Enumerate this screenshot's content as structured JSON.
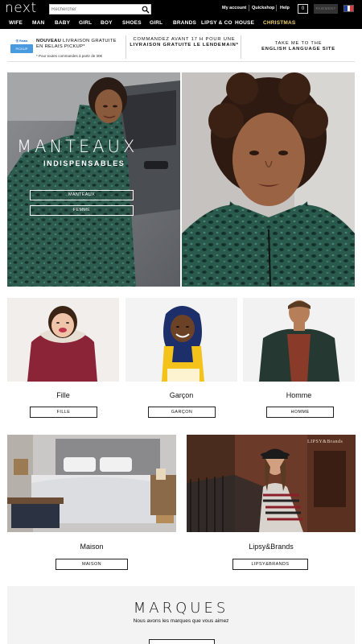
{
  "header": {
    "logo": "next",
    "search_placeholder": "Rechercher",
    "links": [
      "My account",
      "Quickshop",
      "Help"
    ],
    "bag_count": "0",
    "payment_label": "PAIEMENT",
    "flag_colors": [
      "#1f3fa0",
      "#ffffff",
      "#e23a3a"
    ]
  },
  "nav": {
    "items": [
      "WIFE",
      "MAN",
      "BABY",
      "GIRL",
      "BOY",
      "SHOES",
      "GIRL",
      "BRANDS",
      "LIPSY & CO",
      "HOUSE",
      "CHRISTMAS"
    ],
    "highlight_color": "#f0cf6a"
  },
  "promo": {
    "relay": {
      "badge_top": "Ⓡ Relais",
      "badge_box": "PICKUP",
      "title_bold": "NOUVEAU",
      "title_rest": "LIVRAISON GRATUITE EN RELAIS PICKUP*",
      "sub": "* Pour toutes commandes à partir de 30€"
    },
    "delivery": {
      "line1": "COMMANDEZ AVANT 17 H POUR UNE",
      "line2": "LIVRAISON GRATUITE LE LENDEMAIN*"
    },
    "english": {
      "line1": "TAKE ME TO THE",
      "line2": "ENGLISH LANGUAGE SITE"
    }
  },
  "hero": {
    "title": "MANTEAUX",
    "subtitle": "INDISPENSABLES",
    "buttons": [
      "MANTEAUX",
      "FEMME"
    ]
  },
  "categories": [
    {
      "title": "Fille",
      "button": "FILLE"
    },
    {
      "title": "Garçon",
      "button": "GARÇON"
    },
    {
      "title": "Homme",
      "button": "HOMME"
    }
  ],
  "features": [
    {
      "title": "Maison",
      "button": "MAISON"
    },
    {
      "title": "Lipsy&Brands",
      "button": "LIPSY&BRANDS",
      "overlay_logo": "LIPSY&Brands"
    }
  ],
  "marques": {
    "title": "MARQUES",
    "subtitle": "Nous avons les marques que vous aimez"
  }
}
